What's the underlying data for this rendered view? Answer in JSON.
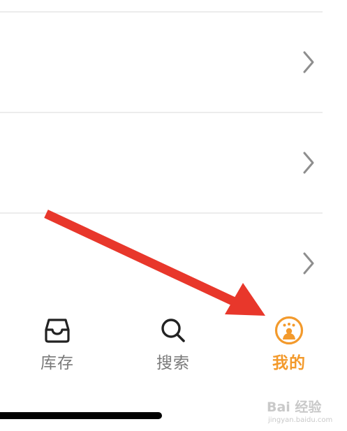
{
  "list": {
    "rows": [
      {
        "chevron_icon": "chevron-right-icon"
      },
      {
        "chevron_icon": "chevron-right-icon"
      },
      {
        "chevron_icon": "chevron-right-icon"
      }
    ]
  },
  "tabbar": {
    "tabs": [
      {
        "label": "库存",
        "icon": "inbox-tray-icon",
        "active": false
      },
      {
        "label": "搜索",
        "icon": "search-icon",
        "active": false
      },
      {
        "label": "我的",
        "icon": "user-avatar-icon",
        "active": true
      }
    ]
  },
  "annotation": {
    "arrow_color": "#e8372b",
    "arrow_icon": "red-arrow-annotation"
  },
  "watermark": {
    "logo_text": "Bai 经验",
    "url": "jingyan.baidu.com"
  },
  "colors": {
    "active_tab": "#f39a2c",
    "inactive_tab": "#7a7a7a",
    "divider": "#ececec",
    "chevron": "#8e8e8e"
  }
}
